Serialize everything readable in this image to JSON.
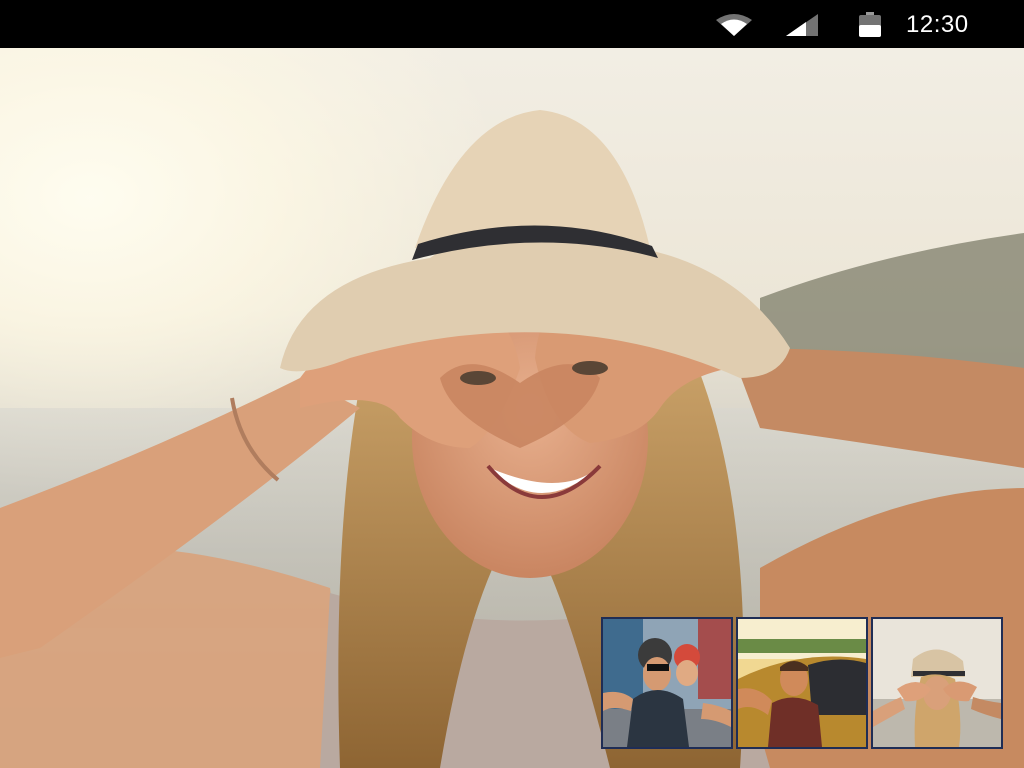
{
  "status_bar": {
    "time": "12:30",
    "icons": [
      "wifi-icon",
      "cellular-signal-icon",
      "battery-icon"
    ]
  },
  "main_photo": {
    "subject": "woman-in-hat-heart-hands"
  },
  "thumbnails": [
    {
      "subject": "couple-helmets-selfie",
      "selected": false
    },
    {
      "subject": "man-car-window-selfie",
      "selected": false
    },
    {
      "subject": "woman-in-hat-heart-hands",
      "selected": true
    }
  ],
  "colors": {
    "status_bar_bg": "#000000",
    "thumb_border": "#1f2d55"
  }
}
